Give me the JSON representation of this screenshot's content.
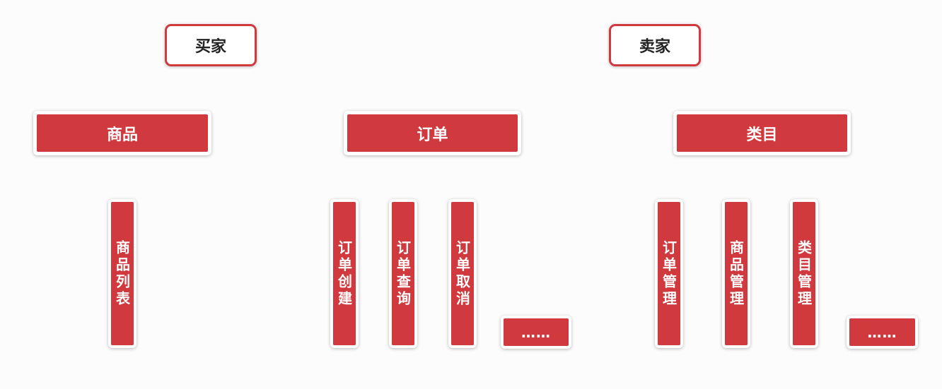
{
  "roles": {
    "buyer": "买家",
    "seller": "卖家"
  },
  "modules": {
    "product": {
      "label": "商品",
      "items": [
        "商品列表"
      ]
    },
    "order": {
      "label": "订单",
      "items": [
        "订单创建",
        "订单查询",
        "订单取消"
      ],
      "more": "……"
    },
    "category": {
      "label": "类目",
      "items": [
        "订单管理",
        "商品管理",
        "类目管理"
      ],
      "more": "……"
    }
  },
  "colors": {
    "accent": "#d0393d",
    "background": "#fdfcfc"
  }
}
